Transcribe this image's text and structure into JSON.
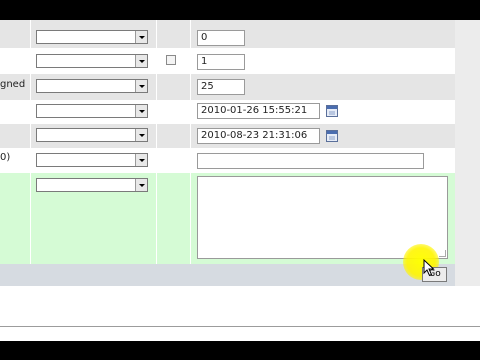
{
  "rows": [
    {
      "label": "",
      "input_value": "0"
    },
    {
      "label": "",
      "input_value": "1"
    },
    {
      "label": "gned",
      "input_value": "25"
    },
    {
      "label": "",
      "input_value": "2010-01-26 15:55:21"
    },
    {
      "label": "",
      "input_value": "2010-08-23 21:31:06"
    },
    {
      "label": "0)",
      "input_value": ""
    },
    {
      "label": "",
      "input_value": ""
    }
  ],
  "go_button": {
    "label": "Go"
  },
  "icons": {
    "calendar": "calendar-icon",
    "dropdown": "chevron-down-icon",
    "cursor": "mouse-pointer-icon"
  },
  "colors": {
    "gray_row": "#e5e5e5",
    "green_row": "#d5fbd5"
  }
}
